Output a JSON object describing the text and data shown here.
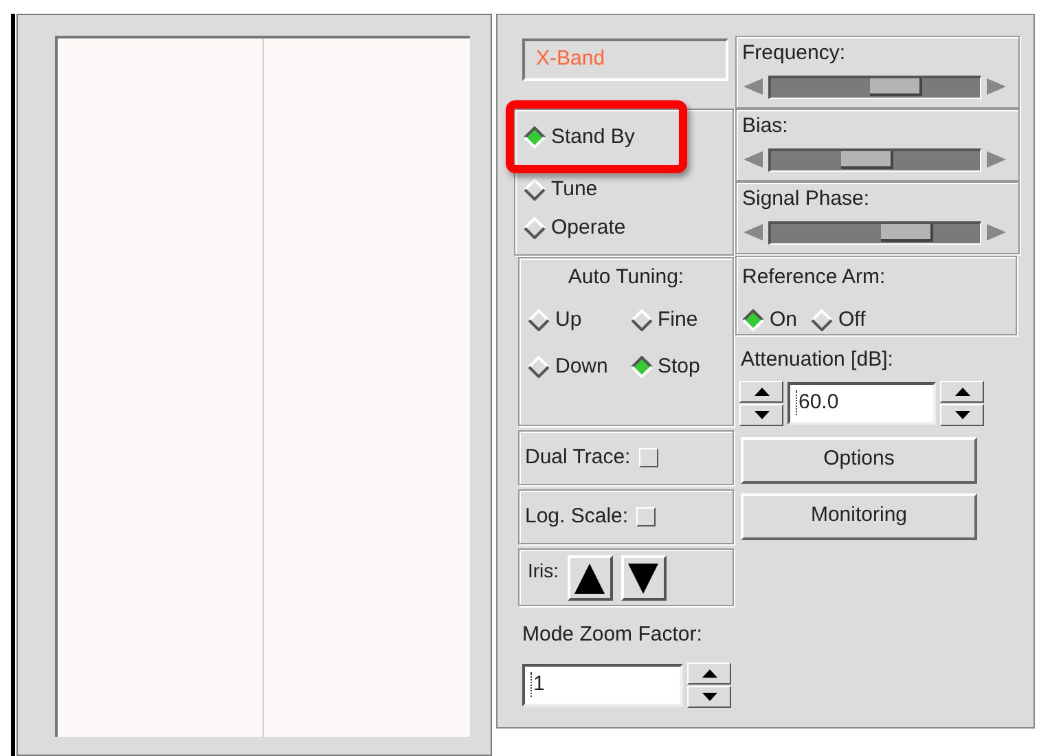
{
  "frequency_band": "X-Band",
  "modes": [
    {
      "label": "Stand By",
      "selected": true,
      "highlighted": true
    },
    {
      "label": "Tune",
      "selected": false,
      "highlighted": false
    },
    {
      "label": "Operate",
      "selected": false,
      "highlighted": false
    }
  ],
  "sliders": [
    {
      "label": "Frequency:",
      "level": 0.64
    },
    {
      "label": "Bias:",
      "level": 0.45
    },
    {
      "label": "Signal Phase:",
      "level": 0.71
    }
  ],
  "auto_tuning": {
    "title": "Auto Tuning:",
    "options": [
      {
        "label": "Up",
        "selected": false
      },
      {
        "label": "Fine",
        "selected": false
      },
      {
        "label": "Down",
        "selected": false
      },
      {
        "label": "Stop",
        "selected": true
      }
    ]
  },
  "reference_arm": {
    "title": "Reference Arm:",
    "options": [
      {
        "label": "On",
        "selected": true
      },
      {
        "label": "Off",
        "selected": false
      }
    ]
  },
  "attenuation": {
    "label": "Attenuation [dB]:",
    "value": "60.0"
  },
  "toggles": [
    {
      "label": "Dual Trace:",
      "checked": false
    },
    {
      "label": "Log. Scale:",
      "checked": false
    }
  ],
  "iris": {
    "label": "Iris:"
  },
  "buttons": [
    "Options",
    "Monitoring"
  ],
  "mode_zoom": {
    "label": "Mode Zoom Factor:",
    "value": "1"
  }
}
